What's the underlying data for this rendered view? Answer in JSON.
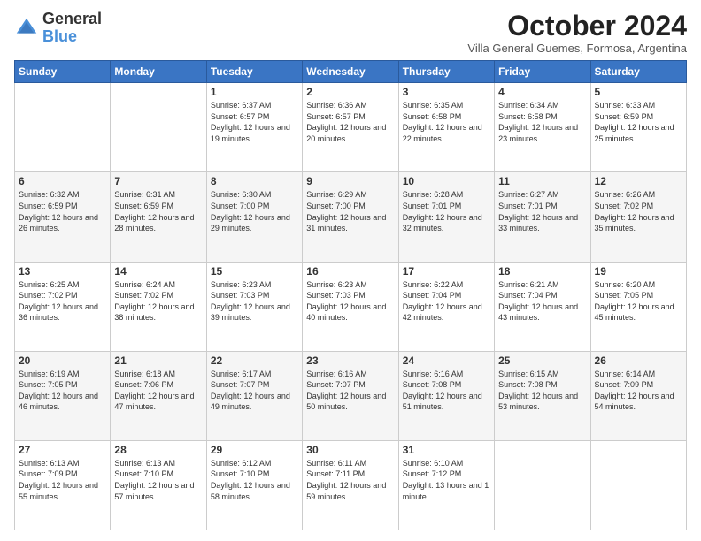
{
  "logo": {
    "general": "General",
    "blue": "Blue"
  },
  "header": {
    "month": "October 2024",
    "location": "Villa General Guemes, Formosa, Argentina"
  },
  "days_of_week": [
    "Sunday",
    "Monday",
    "Tuesday",
    "Wednesday",
    "Thursday",
    "Friday",
    "Saturday"
  ],
  "weeks": [
    [
      {
        "day": "",
        "content": ""
      },
      {
        "day": "",
        "content": ""
      },
      {
        "day": "1",
        "content": "Sunrise: 6:37 AM\nSunset: 6:57 PM\nDaylight: 12 hours and 19 minutes."
      },
      {
        "day": "2",
        "content": "Sunrise: 6:36 AM\nSunset: 6:57 PM\nDaylight: 12 hours and 20 minutes."
      },
      {
        "day": "3",
        "content": "Sunrise: 6:35 AM\nSunset: 6:58 PM\nDaylight: 12 hours and 22 minutes."
      },
      {
        "day": "4",
        "content": "Sunrise: 6:34 AM\nSunset: 6:58 PM\nDaylight: 12 hours and 23 minutes."
      },
      {
        "day": "5",
        "content": "Sunrise: 6:33 AM\nSunset: 6:59 PM\nDaylight: 12 hours and 25 minutes."
      }
    ],
    [
      {
        "day": "6",
        "content": "Sunrise: 6:32 AM\nSunset: 6:59 PM\nDaylight: 12 hours and 26 minutes."
      },
      {
        "day": "7",
        "content": "Sunrise: 6:31 AM\nSunset: 6:59 PM\nDaylight: 12 hours and 28 minutes."
      },
      {
        "day": "8",
        "content": "Sunrise: 6:30 AM\nSunset: 7:00 PM\nDaylight: 12 hours and 29 minutes."
      },
      {
        "day": "9",
        "content": "Sunrise: 6:29 AM\nSunset: 7:00 PM\nDaylight: 12 hours and 31 minutes."
      },
      {
        "day": "10",
        "content": "Sunrise: 6:28 AM\nSunset: 7:01 PM\nDaylight: 12 hours and 32 minutes."
      },
      {
        "day": "11",
        "content": "Sunrise: 6:27 AM\nSunset: 7:01 PM\nDaylight: 12 hours and 33 minutes."
      },
      {
        "day": "12",
        "content": "Sunrise: 6:26 AM\nSunset: 7:02 PM\nDaylight: 12 hours and 35 minutes."
      }
    ],
    [
      {
        "day": "13",
        "content": "Sunrise: 6:25 AM\nSunset: 7:02 PM\nDaylight: 12 hours and 36 minutes."
      },
      {
        "day": "14",
        "content": "Sunrise: 6:24 AM\nSunset: 7:02 PM\nDaylight: 12 hours and 38 minutes."
      },
      {
        "day": "15",
        "content": "Sunrise: 6:23 AM\nSunset: 7:03 PM\nDaylight: 12 hours and 39 minutes."
      },
      {
        "day": "16",
        "content": "Sunrise: 6:23 AM\nSunset: 7:03 PM\nDaylight: 12 hours and 40 minutes."
      },
      {
        "day": "17",
        "content": "Sunrise: 6:22 AM\nSunset: 7:04 PM\nDaylight: 12 hours and 42 minutes."
      },
      {
        "day": "18",
        "content": "Sunrise: 6:21 AM\nSunset: 7:04 PM\nDaylight: 12 hours and 43 minutes."
      },
      {
        "day": "19",
        "content": "Sunrise: 6:20 AM\nSunset: 7:05 PM\nDaylight: 12 hours and 45 minutes."
      }
    ],
    [
      {
        "day": "20",
        "content": "Sunrise: 6:19 AM\nSunset: 7:05 PM\nDaylight: 12 hours and 46 minutes."
      },
      {
        "day": "21",
        "content": "Sunrise: 6:18 AM\nSunset: 7:06 PM\nDaylight: 12 hours and 47 minutes."
      },
      {
        "day": "22",
        "content": "Sunrise: 6:17 AM\nSunset: 7:07 PM\nDaylight: 12 hours and 49 minutes."
      },
      {
        "day": "23",
        "content": "Sunrise: 6:16 AM\nSunset: 7:07 PM\nDaylight: 12 hours and 50 minutes."
      },
      {
        "day": "24",
        "content": "Sunrise: 6:16 AM\nSunset: 7:08 PM\nDaylight: 12 hours and 51 minutes."
      },
      {
        "day": "25",
        "content": "Sunrise: 6:15 AM\nSunset: 7:08 PM\nDaylight: 12 hours and 53 minutes."
      },
      {
        "day": "26",
        "content": "Sunrise: 6:14 AM\nSunset: 7:09 PM\nDaylight: 12 hours and 54 minutes."
      }
    ],
    [
      {
        "day": "27",
        "content": "Sunrise: 6:13 AM\nSunset: 7:09 PM\nDaylight: 12 hours and 55 minutes."
      },
      {
        "day": "28",
        "content": "Sunrise: 6:13 AM\nSunset: 7:10 PM\nDaylight: 12 hours and 57 minutes."
      },
      {
        "day": "29",
        "content": "Sunrise: 6:12 AM\nSunset: 7:10 PM\nDaylight: 12 hours and 58 minutes."
      },
      {
        "day": "30",
        "content": "Sunrise: 6:11 AM\nSunset: 7:11 PM\nDaylight: 12 hours and 59 minutes."
      },
      {
        "day": "31",
        "content": "Sunrise: 6:10 AM\nSunset: 7:12 PM\nDaylight: 13 hours and 1 minute."
      },
      {
        "day": "",
        "content": ""
      },
      {
        "day": "",
        "content": ""
      }
    ]
  ]
}
